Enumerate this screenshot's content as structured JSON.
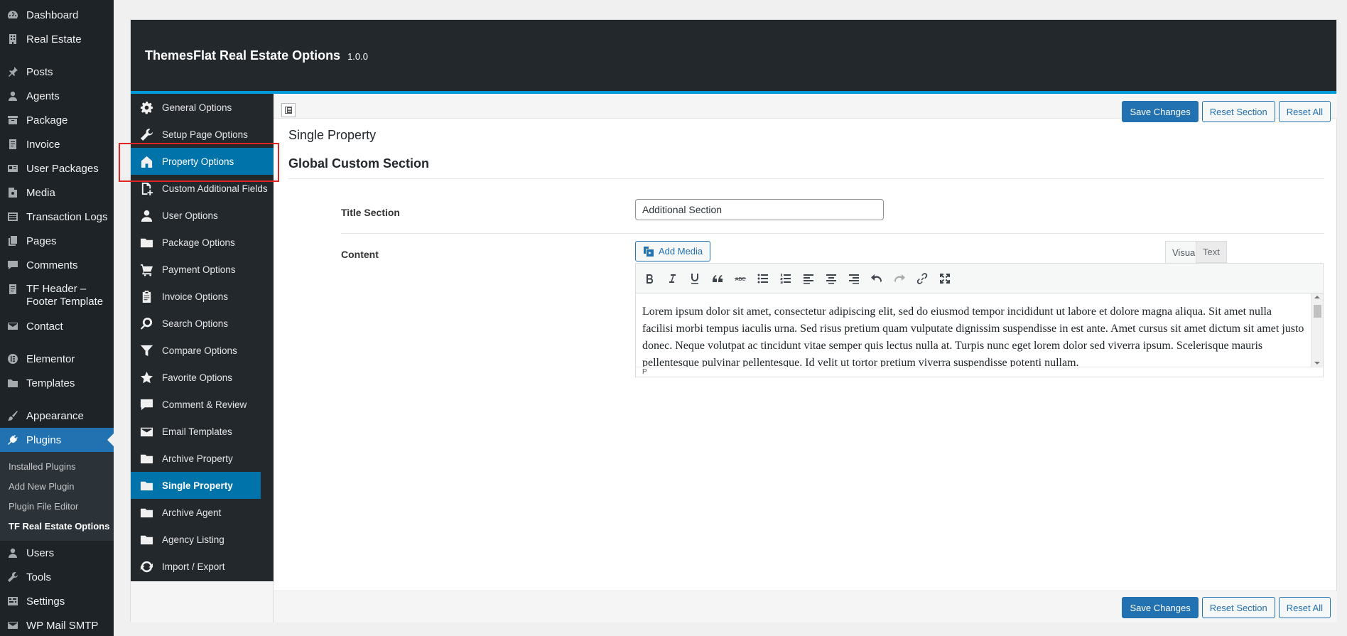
{
  "wp_menu": {
    "items": [
      {
        "label": "Dashboard",
        "icon": "dashboard-icon"
      },
      {
        "label": "Real Estate",
        "icon": "building-icon"
      },
      {
        "label": "Posts",
        "icon": "pin-icon"
      },
      {
        "label": "Agents",
        "icon": "user-icon"
      },
      {
        "label": "Package",
        "icon": "archive-icon"
      },
      {
        "label": "Invoice",
        "icon": "document-icon"
      },
      {
        "label": "User Packages",
        "icon": "id-card-icon"
      },
      {
        "label": "Media",
        "icon": "media-icon"
      },
      {
        "label": "Transaction Logs",
        "icon": "list-icon"
      },
      {
        "label": "Pages",
        "icon": "pages-icon"
      },
      {
        "label": "Comments",
        "icon": "comment-icon"
      },
      {
        "label": "TF Header – Footer Template",
        "icon": "document-icon"
      },
      {
        "label": "Contact",
        "icon": "email-icon"
      },
      {
        "label": "Elementor",
        "icon": "elementor-icon"
      },
      {
        "label": "Templates",
        "icon": "folder-icon"
      },
      {
        "label": "Appearance",
        "icon": "brush-icon"
      },
      {
        "label": "Plugins",
        "icon": "plugin-icon"
      },
      {
        "label": "Users",
        "icon": "user-icon"
      },
      {
        "label": "Tools",
        "icon": "wrench-icon"
      },
      {
        "label": "Settings",
        "icon": "settings-icon"
      },
      {
        "label": "WP Mail SMTP",
        "icon": "email-icon"
      }
    ],
    "plugins_submenu": [
      "Installed Plugins",
      "Add New Plugin",
      "Plugin File Editor",
      "TF Real Estate Options"
    ]
  },
  "panel": {
    "title": "ThemesFlat Real Estate Options",
    "version": "1.0.0"
  },
  "sidenav": {
    "items": [
      {
        "label": "General Options",
        "icon": "gear-icon"
      },
      {
        "label": "Setup Page Options",
        "icon": "wrench-icon"
      },
      {
        "label": "Property Options",
        "icon": "home-icon"
      },
      {
        "label": "Custom Additional Fields",
        "icon": "add-document-icon"
      },
      {
        "label": "User Options",
        "icon": "user-icon"
      },
      {
        "label": "Package Options",
        "icon": "folder-icon"
      },
      {
        "label": "Payment Options",
        "icon": "cart-icon"
      },
      {
        "label": "Invoice Options",
        "icon": "clipboard-icon"
      },
      {
        "label": "Search Options",
        "icon": "search-icon"
      },
      {
        "label": "Compare Options",
        "icon": "filter-icon"
      },
      {
        "label": "Favorite Options",
        "icon": "star-icon"
      },
      {
        "label": "Comment & Review",
        "icon": "comment-icon"
      },
      {
        "label": "Email Templates",
        "icon": "email-icon"
      },
      {
        "label": "Archive Property",
        "icon": "folder-icon"
      },
      {
        "label": "Single Property",
        "icon": "folder-icon"
      },
      {
        "label": "Archive Agent",
        "icon": "folder-icon"
      },
      {
        "label": "Agency Listing",
        "icon": "folder-icon"
      },
      {
        "label": "Import / Export",
        "icon": "refresh-icon"
      }
    ]
  },
  "main": {
    "buttons": {
      "save": "Save Changes",
      "reset_section": "Reset Section",
      "reset_all": "Reset All"
    },
    "section_title": "Single Property",
    "section_subtitle": "Global Custom Section",
    "title_field": {
      "label": "Title Section",
      "value": "Additional Section"
    },
    "content_field": {
      "label": "Content",
      "add_media": "Add Media",
      "tab_visual": "Visual",
      "tab_text": "Text",
      "body": "Lorem ipsum dolor sit amet, consectetur adipiscing elit, sed do eiusmod tempor incididunt ut labore et dolore magna aliqua. Sit amet nulla facilisi morbi tempus iaculis urna. Sed risus pretium quam vulputate dignissim suspendisse in est ante. Amet cursus sit amet dictum sit amet justo donec. Neque volutpat ac tincidunt vitae semper quis lectus nulla at. Turpis nunc eget lorem dolor sed viverra ipsum. Scelerisque mauris pellentesque pulvinar pellentesque. Id velit ut tortor pretium viverra suspendisse potenti nullam.",
      "status": "P"
    }
  },
  "colors": {
    "accent": "#2271b1",
    "sidebar": "#1d2327",
    "highlight": "#0073aa",
    "header_border": "#0099d9",
    "annotation": "#e02424"
  }
}
